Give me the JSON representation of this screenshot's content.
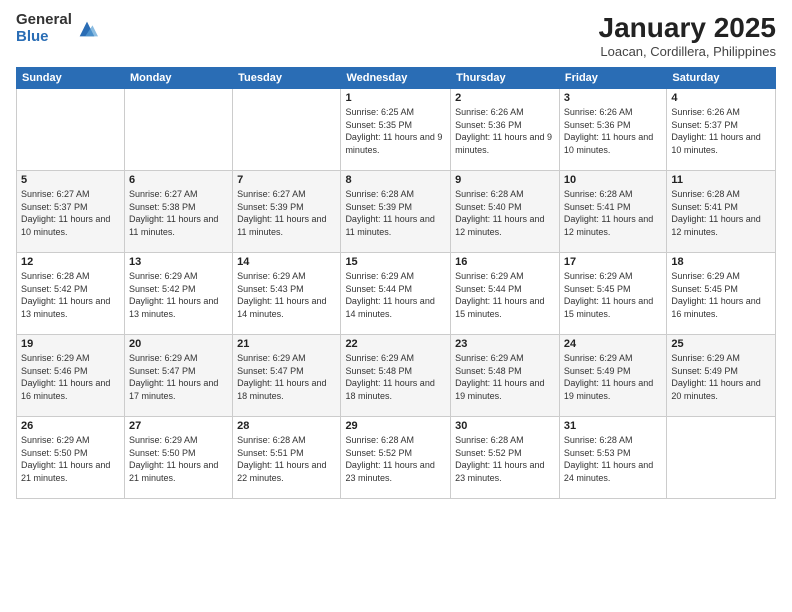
{
  "logo": {
    "general": "General",
    "blue": "Blue"
  },
  "header": {
    "month": "January 2025",
    "location": "Loacan, Cordillera, Philippines"
  },
  "weekdays": [
    "Sunday",
    "Monday",
    "Tuesday",
    "Wednesday",
    "Thursday",
    "Friday",
    "Saturday"
  ],
  "weeks": [
    [
      {
        "day": "",
        "info": ""
      },
      {
        "day": "",
        "info": ""
      },
      {
        "day": "",
        "info": ""
      },
      {
        "day": "1",
        "info": "Sunrise: 6:25 AM\nSunset: 5:35 PM\nDaylight: 11 hours\nand 9 minutes."
      },
      {
        "day": "2",
        "info": "Sunrise: 6:26 AM\nSunset: 5:36 PM\nDaylight: 11 hours\nand 9 minutes."
      },
      {
        "day": "3",
        "info": "Sunrise: 6:26 AM\nSunset: 5:36 PM\nDaylight: 11 hours\nand 10 minutes."
      },
      {
        "day": "4",
        "info": "Sunrise: 6:26 AM\nSunset: 5:37 PM\nDaylight: 11 hours\nand 10 minutes."
      }
    ],
    [
      {
        "day": "5",
        "info": "Sunrise: 6:27 AM\nSunset: 5:37 PM\nDaylight: 11 hours\nand 10 minutes."
      },
      {
        "day": "6",
        "info": "Sunrise: 6:27 AM\nSunset: 5:38 PM\nDaylight: 11 hours\nand 11 minutes."
      },
      {
        "day": "7",
        "info": "Sunrise: 6:27 AM\nSunset: 5:39 PM\nDaylight: 11 hours\nand 11 minutes."
      },
      {
        "day": "8",
        "info": "Sunrise: 6:28 AM\nSunset: 5:39 PM\nDaylight: 11 hours\nand 11 minutes."
      },
      {
        "day": "9",
        "info": "Sunrise: 6:28 AM\nSunset: 5:40 PM\nDaylight: 11 hours\nand 12 minutes."
      },
      {
        "day": "10",
        "info": "Sunrise: 6:28 AM\nSunset: 5:41 PM\nDaylight: 11 hours\nand 12 minutes."
      },
      {
        "day": "11",
        "info": "Sunrise: 6:28 AM\nSunset: 5:41 PM\nDaylight: 11 hours\nand 12 minutes."
      }
    ],
    [
      {
        "day": "12",
        "info": "Sunrise: 6:28 AM\nSunset: 5:42 PM\nDaylight: 11 hours\nand 13 minutes."
      },
      {
        "day": "13",
        "info": "Sunrise: 6:29 AM\nSunset: 5:42 PM\nDaylight: 11 hours\nand 13 minutes."
      },
      {
        "day": "14",
        "info": "Sunrise: 6:29 AM\nSunset: 5:43 PM\nDaylight: 11 hours\nand 14 minutes."
      },
      {
        "day": "15",
        "info": "Sunrise: 6:29 AM\nSunset: 5:44 PM\nDaylight: 11 hours\nand 14 minutes."
      },
      {
        "day": "16",
        "info": "Sunrise: 6:29 AM\nSunset: 5:44 PM\nDaylight: 11 hours\nand 15 minutes."
      },
      {
        "day": "17",
        "info": "Sunrise: 6:29 AM\nSunset: 5:45 PM\nDaylight: 11 hours\nand 15 minutes."
      },
      {
        "day": "18",
        "info": "Sunrise: 6:29 AM\nSunset: 5:45 PM\nDaylight: 11 hours\nand 16 minutes."
      }
    ],
    [
      {
        "day": "19",
        "info": "Sunrise: 6:29 AM\nSunset: 5:46 PM\nDaylight: 11 hours\nand 16 minutes."
      },
      {
        "day": "20",
        "info": "Sunrise: 6:29 AM\nSunset: 5:47 PM\nDaylight: 11 hours\nand 17 minutes."
      },
      {
        "day": "21",
        "info": "Sunrise: 6:29 AM\nSunset: 5:47 PM\nDaylight: 11 hours\nand 18 minutes."
      },
      {
        "day": "22",
        "info": "Sunrise: 6:29 AM\nSunset: 5:48 PM\nDaylight: 11 hours\nand 18 minutes."
      },
      {
        "day": "23",
        "info": "Sunrise: 6:29 AM\nSunset: 5:48 PM\nDaylight: 11 hours\nand 19 minutes."
      },
      {
        "day": "24",
        "info": "Sunrise: 6:29 AM\nSunset: 5:49 PM\nDaylight: 11 hours\nand 19 minutes."
      },
      {
        "day": "25",
        "info": "Sunrise: 6:29 AM\nSunset: 5:49 PM\nDaylight: 11 hours\nand 20 minutes."
      }
    ],
    [
      {
        "day": "26",
        "info": "Sunrise: 6:29 AM\nSunset: 5:50 PM\nDaylight: 11 hours\nand 21 minutes."
      },
      {
        "day": "27",
        "info": "Sunrise: 6:29 AM\nSunset: 5:50 PM\nDaylight: 11 hours\nand 21 minutes."
      },
      {
        "day": "28",
        "info": "Sunrise: 6:28 AM\nSunset: 5:51 PM\nDaylight: 11 hours\nand 22 minutes."
      },
      {
        "day": "29",
        "info": "Sunrise: 6:28 AM\nSunset: 5:52 PM\nDaylight: 11 hours\nand 23 minutes."
      },
      {
        "day": "30",
        "info": "Sunrise: 6:28 AM\nSunset: 5:52 PM\nDaylight: 11 hours\nand 23 minutes."
      },
      {
        "day": "31",
        "info": "Sunrise: 6:28 AM\nSunset: 5:53 PM\nDaylight: 11 hours\nand 24 minutes."
      },
      {
        "day": "",
        "info": ""
      }
    ]
  ]
}
